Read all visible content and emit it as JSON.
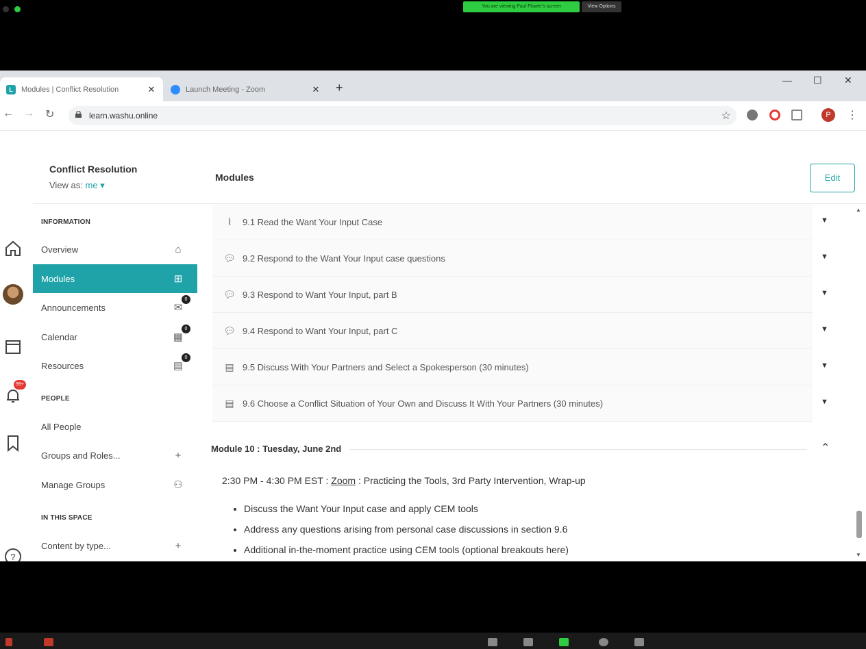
{
  "zoom": {
    "share_banner": "You are viewing Paul Flower's screen",
    "view_options": "View Options"
  },
  "browser": {
    "tabs": [
      {
        "title": "Modules | Conflict Resolution",
        "active": true,
        "favicon": "L"
      },
      {
        "title": "Launch Meeting - Zoom",
        "active": false
      }
    ],
    "url": "learn.washu.online",
    "profile_initial": "P"
  },
  "rail": {
    "notification_badge": "99+"
  },
  "sidebar": {
    "course_title": "Conflict Resolution",
    "view_as_label": "View as:",
    "view_as_value": "me",
    "sections": {
      "information": "INFORMATION",
      "people": "PEOPLE",
      "in_this_space": "IN THIS SPACE"
    },
    "items": [
      {
        "label": "Overview",
        "icon": "home-icon"
      },
      {
        "label": "Modules",
        "icon": "modules-icon"
      },
      {
        "label": "Announcements",
        "icon": "announcement-icon",
        "count": "0"
      },
      {
        "label": "Calendar",
        "icon": "calendar-icon",
        "count": "0"
      },
      {
        "label": "Resources",
        "icon": "resources-icon",
        "count": "0"
      },
      {
        "label": "All People"
      },
      {
        "label": "Groups and Roles...",
        "icon": "plus-icon"
      },
      {
        "label": "Manage Groups",
        "icon": "groups-icon"
      },
      {
        "label": "Content by type...",
        "icon": "plus-icon"
      }
    ]
  },
  "main": {
    "title": "Modules",
    "edit_label": "Edit",
    "module_items": [
      {
        "label": "9.1 Read the Want Your Input Case",
        "icon": "paperclip-icon"
      },
      {
        "label": "9.2 Respond to the Want Your Input case questions",
        "icon": "discussion-icon"
      },
      {
        "label": "9.3 Respond to Want Your Input, part B",
        "icon": "discussion-icon"
      },
      {
        "label": "9.4 Respond to Want Your Input, part C",
        "icon": "discussion-icon"
      },
      {
        "label": "9.5 Discuss With Your Partners and Select a Spokesperson (30 minutes)",
        "icon": "activity-icon"
      },
      {
        "label": "9.6 Choose a Conflict Situation of Your Own and Discuss It With Your Partners (30 minutes)",
        "icon": "activity-icon"
      }
    ],
    "module10": {
      "heading": "Module 10 : Tuesday, June 2nd",
      "time": "2:30 PM - 4:30 PM EST :",
      "zoom_link": "Zoom",
      "topic": ": Practicing the Tools, 3rd Party Intervention, Wrap-up",
      "bullets": [
        "Discuss the Want Your Input case and apply CEM tools",
        "Address any questions arising from personal case discussions in section 9.6",
        "Additional in-the-moment practice using CEM tools (optional breakouts here)"
      ]
    }
  }
}
